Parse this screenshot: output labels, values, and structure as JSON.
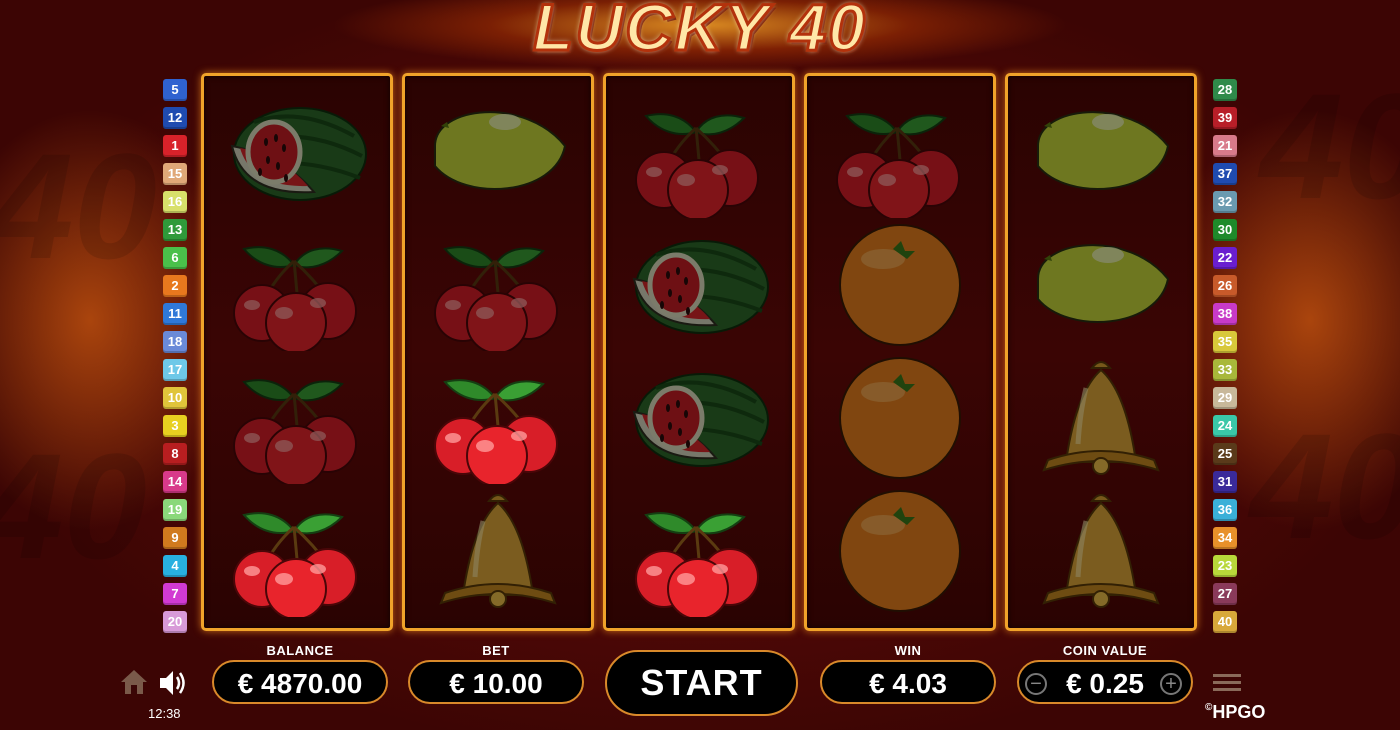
{
  "game": {
    "title": "LUCKY 40",
    "brand": "HPGO",
    "brand_prefix": "©"
  },
  "paylines": {
    "left": [
      {
        "n": "5",
        "color": "#2f62d0"
      },
      {
        "n": "12",
        "color": "#1f4bb0"
      },
      {
        "n": "1",
        "color": "#d8222a"
      },
      {
        "n": "15",
        "color": "#e0a878"
      },
      {
        "n": "16",
        "color": "#d8e06a"
      },
      {
        "n": "13",
        "color": "#2f9a3a"
      },
      {
        "n": "6",
        "color": "#4ac04a"
      },
      {
        "n": "2",
        "color": "#e8781e"
      },
      {
        "n": "11",
        "color": "#2f78d8"
      },
      {
        "n": "18",
        "color": "#6a8ad8"
      },
      {
        "n": "17",
        "color": "#6ec8e8"
      },
      {
        "n": "10",
        "color": "#e0c43a"
      },
      {
        "n": "3",
        "color": "#e8d020"
      },
      {
        "n": "8",
        "color": "#b81e20"
      },
      {
        "n": "14",
        "color": "#d83a8a"
      },
      {
        "n": "19",
        "color": "#8ad87a"
      },
      {
        "n": "9",
        "color": "#d07a1e"
      },
      {
        "n": "4",
        "color": "#28b0e0"
      },
      {
        "n": "7",
        "color": "#d23ad2"
      },
      {
        "n": "20",
        "color": "#d89ad8"
      }
    ],
    "right": [
      {
        "n": "28",
        "color": "#2f8a4a"
      },
      {
        "n": "39",
        "color": "#b81e28"
      },
      {
        "n": "21",
        "color": "#d87a8a"
      },
      {
        "n": "37",
        "color": "#1f4bb0"
      },
      {
        "n": "32",
        "color": "#6a9ab0"
      },
      {
        "n": "30",
        "color": "#1e8a2a"
      },
      {
        "n": "22",
        "color": "#6a1ed0"
      },
      {
        "n": "26",
        "color": "#c85a2a"
      },
      {
        "n": "38",
        "color": "#c83ac8"
      },
      {
        "n": "35",
        "color": "#d8c83a"
      },
      {
        "n": "33",
        "color": "#a8b83a"
      },
      {
        "n": "29",
        "color": "#c8b89a"
      },
      {
        "n": "24",
        "color": "#3ac8a8"
      },
      {
        "n": "25",
        "color": "#5a3a1a"
      },
      {
        "n": "31",
        "color": "#3a2a9a"
      },
      {
        "n": "36",
        "color": "#3ab0d8"
      },
      {
        "n": "34",
        "color": "#e8902a"
      },
      {
        "n": "23",
        "color": "#b8d83a"
      },
      {
        "n": "27",
        "color": "#8a3a5a"
      },
      {
        "n": "40",
        "color": "#d8a83a"
      }
    ]
  },
  "reels": [
    [
      {
        "symbol": "watermelon",
        "dim": true
      },
      {
        "symbol": "cherry",
        "dim": true
      },
      {
        "symbol": "cherry",
        "dim": true
      },
      {
        "symbol": "cherry",
        "dim": false
      }
    ],
    [
      {
        "symbol": "lemon",
        "dim": true
      },
      {
        "symbol": "cherry",
        "dim": true
      },
      {
        "symbol": "cherry",
        "dim": false
      },
      {
        "symbol": "bell",
        "dim": true
      }
    ],
    [
      {
        "symbol": "cherry",
        "dim": true
      },
      {
        "symbol": "watermelon",
        "dim": true
      },
      {
        "symbol": "watermelon",
        "dim": true
      },
      {
        "symbol": "cherry",
        "dim": false
      }
    ],
    [
      {
        "symbol": "cherry",
        "dim": true
      },
      {
        "symbol": "orange",
        "dim": true
      },
      {
        "symbol": "orange",
        "dim": true
      },
      {
        "symbol": "orange",
        "dim": true
      }
    ],
    [
      {
        "symbol": "lemon",
        "dim": true
      },
      {
        "symbol": "lemon",
        "dim": true
      },
      {
        "symbol": "bell",
        "dim": true
      },
      {
        "symbol": "bell",
        "dim": true
      }
    ]
  ],
  "panel": {
    "balance_label": "BALANCE",
    "balance_value": "€ 4870.00",
    "bet_label": "BET",
    "bet_value": "€ 10.00",
    "start_label": "START",
    "win_label": "WIN",
    "win_value": "€ 4.03",
    "coin_label": "COIN VALUE",
    "coin_value": "€ 0.25",
    "minus": "−",
    "plus": "+"
  },
  "status": {
    "clock": "12:38"
  },
  "icons": {
    "home": "home-icon",
    "sound": "speaker-icon",
    "menu": "hamburger-menu-icon"
  }
}
